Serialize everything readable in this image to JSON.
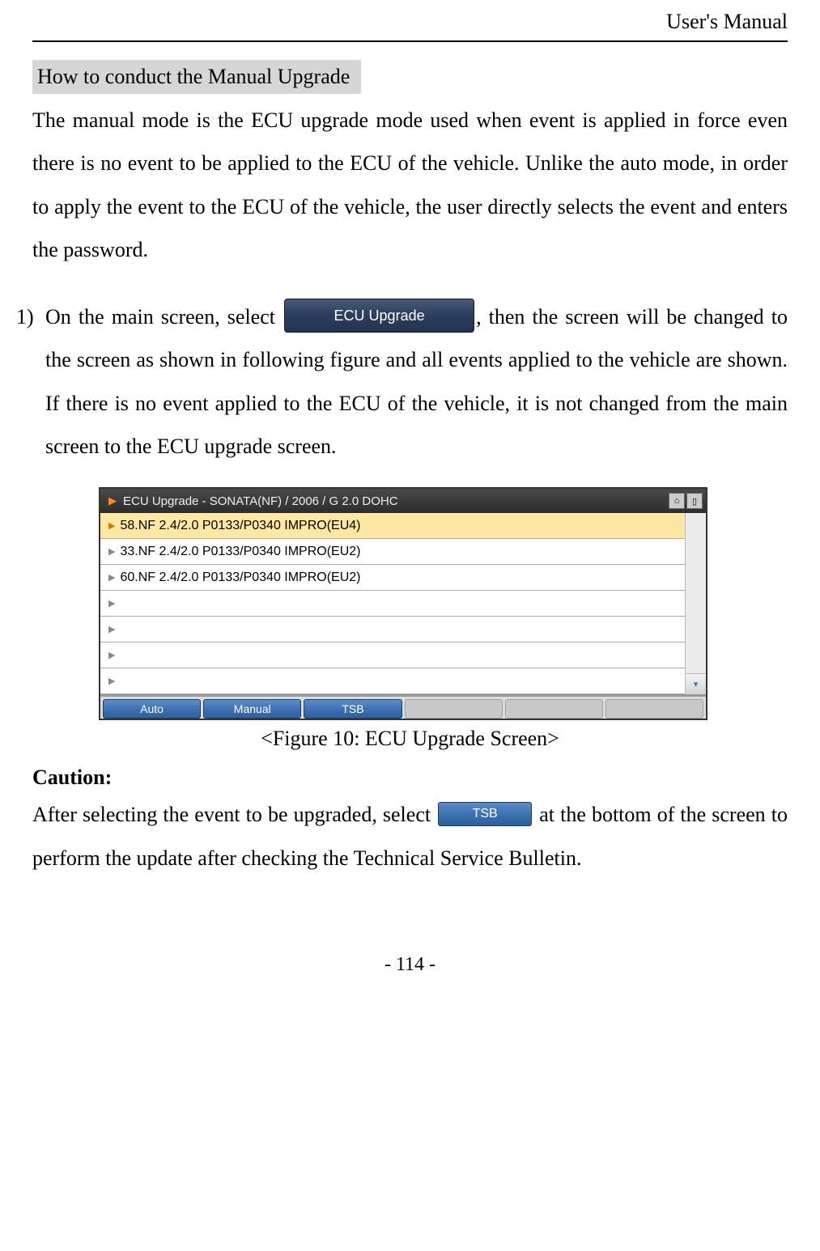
{
  "header": {
    "right": "User's Manual"
  },
  "section": {
    "heading": "How to conduct the Manual Upgrade",
    "intro": "The manual mode is the ECU upgrade mode used when event is applied in force even there is no event to be applied to the ECU of the vehicle. Unlike the auto mode, in order to apply the event to the ECU of the vehicle, the user directly selects the event and enters the password."
  },
  "step1": {
    "marker": "1)",
    "text_a": "On the main screen, select ",
    "ecu_button_label": "ECU Upgrade",
    "text_b": ", then the screen will be changed to the screen as shown in following figure and all events applied to the vehicle are shown. If there is no event applied to the ECU of the vehicle, it is not changed from the main screen to the ECU upgrade screen."
  },
  "figure": {
    "titlebar": "ECU Upgrade - SONATA(NF) / 2006 / G 2.0 DOHC",
    "rows": [
      "58.NF 2.4/2.0 P0133/P0340 IMPRO(EU4)",
      "33.NF 2.4/2.0 P0133/P0340 IMPRO(EU2)",
      "60.NF 2.4/2.0 P0133/P0340 IMPRO(EU2)",
      "",
      "",
      "",
      ""
    ],
    "tabs": [
      "Auto",
      "Manual",
      "TSB"
    ],
    "caption": "<Figure 10: ECU Upgrade Screen>"
  },
  "caution": {
    "heading": "Caution:",
    "text_a": "After selecting the event to be upgraded, select ",
    "tsb_button_label": "TSB",
    "text_b": " at the bottom of the screen to perform the update after checking the Technical Service Bulletin."
  },
  "footer": {
    "page": "- 114 -"
  }
}
